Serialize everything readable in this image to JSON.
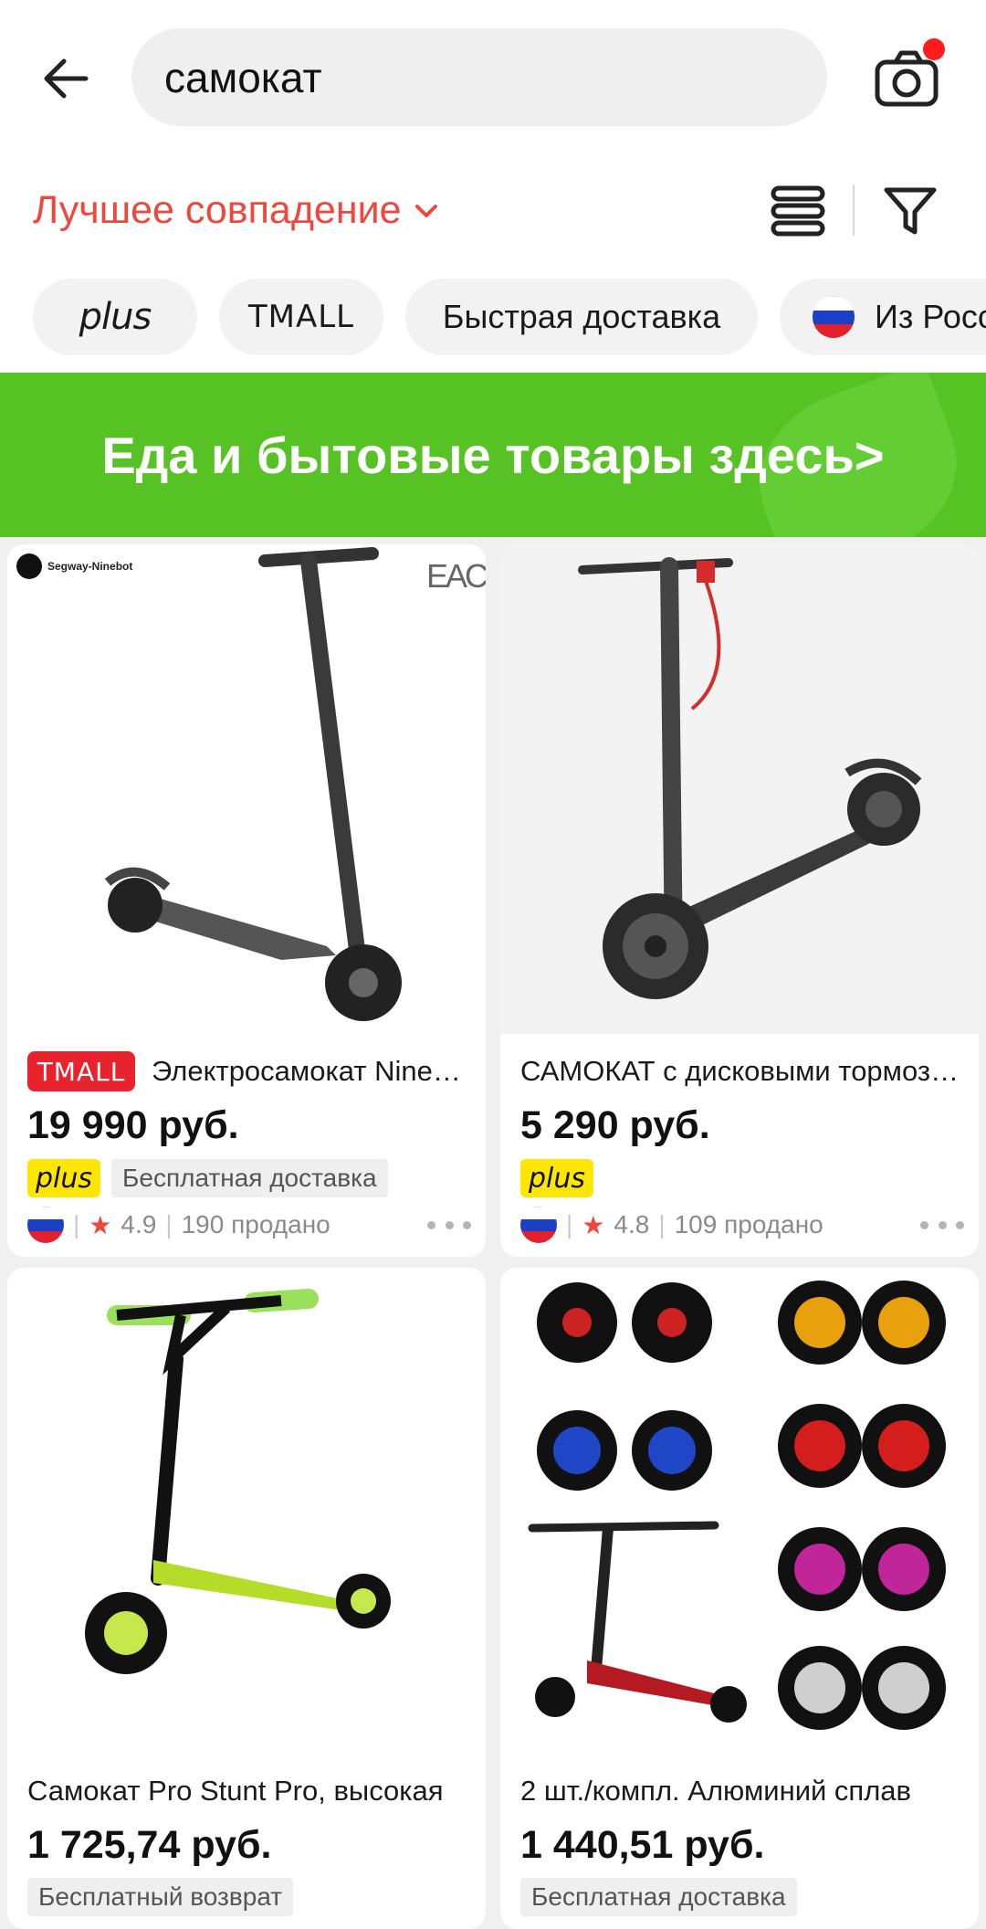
{
  "header": {
    "search_value": "самокат"
  },
  "sort": {
    "label": "Лучшее совпадение"
  },
  "chips": {
    "plus": "plus",
    "tmall": "TMALL",
    "fast": "Быстрая доставка",
    "russia": "Из России"
  },
  "banner": {
    "text": "Еда и бытовые товары здесь>",
    "color": "#56c224"
  },
  "products": [
    {
      "title": "Электросамокат Ninebot",
      "store_badge": "TMALL",
      "brand": "Segway-Ninebot",
      "cert": "EAC",
      "price": "19 990 руб.",
      "plus": "plus",
      "shipping": "Бесплатная доставка",
      "rating": "4.9",
      "sold": "190 продано"
    },
    {
      "title": "САМОКАТ с дисковыми тормозами",
      "price": "5 290 руб.",
      "plus": "plus",
      "rating": "4.8",
      "sold": "109 продано"
    },
    {
      "title": "Самокат Pro Stunt Pro, высокая",
      "price": "1 725,74 руб.",
      "badge": "Бесплатный возврат"
    },
    {
      "title": "2 шт./компл. Алюминий сплав",
      "price": "1 440,51 руб.",
      "badge": "Бесплатная доставка"
    }
  ],
  "colors": {
    "accent": "#f0473d",
    "tmall": "#e8232e",
    "plus": "#ffe600"
  }
}
